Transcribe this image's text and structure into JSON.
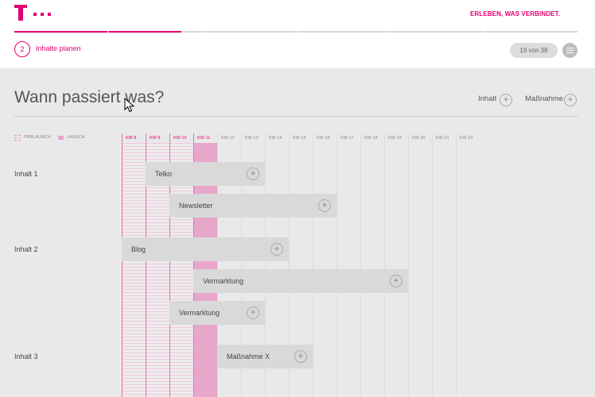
{
  "brand": {
    "claim": "ERLEBEN, WAS VERBINDET.",
    "accent": "#e20074"
  },
  "wizard": {
    "step_number": "2",
    "step_label": "Inhalte planen",
    "counter": "19 von 38",
    "progress_segments": 6
  },
  "page": {
    "title": "Wann passiert was?",
    "actions": [
      {
        "label": "Inhalt",
        "icon": "plus-icon"
      },
      {
        "label": "Maßnahme",
        "icon": "plus-icon"
      }
    ]
  },
  "legend": {
    "prelaunch": "PRELAUNCH",
    "launch": "LAUNCH"
  },
  "timeline": {
    "weeks": [
      "KW 8",
      "KW 9",
      "KW 10",
      "KW 11",
      "KW 12",
      "KW 13",
      "KW 14",
      "KW 15",
      "KW 16",
      "KW 17",
      "KW 18",
      "KW 19",
      "KW 20",
      "KW 21",
      "KW 22"
    ],
    "prelaunch_weeks": [
      "KW 8",
      "KW 9",
      "KW 10"
    ],
    "launch_weeks": [
      "KW 11"
    ]
  },
  "rows": [
    {
      "label": "Inhalt 1",
      "bars": [
        {
          "label": "Telko",
          "start": "KW 9",
          "end": "KW 13"
        },
        {
          "label": "Newsletter",
          "start": "KW 10",
          "end": "KW 16"
        }
      ]
    },
    {
      "label": "Inhalt 2",
      "bars": [
        {
          "label": "Blog",
          "start": "KW 8",
          "end": "KW 14"
        },
        {
          "label": "Vermarktung",
          "start": "KW 11",
          "end": "KW 19"
        },
        {
          "label": "Vermarktung",
          "start": "KW 10",
          "end": "KW 13"
        }
      ]
    },
    {
      "label": "Inhalt 3",
      "bars": [
        {
          "label": "Maßnahme X",
          "start": "KW 12",
          "end": "KW 15"
        }
      ]
    }
  ]
}
